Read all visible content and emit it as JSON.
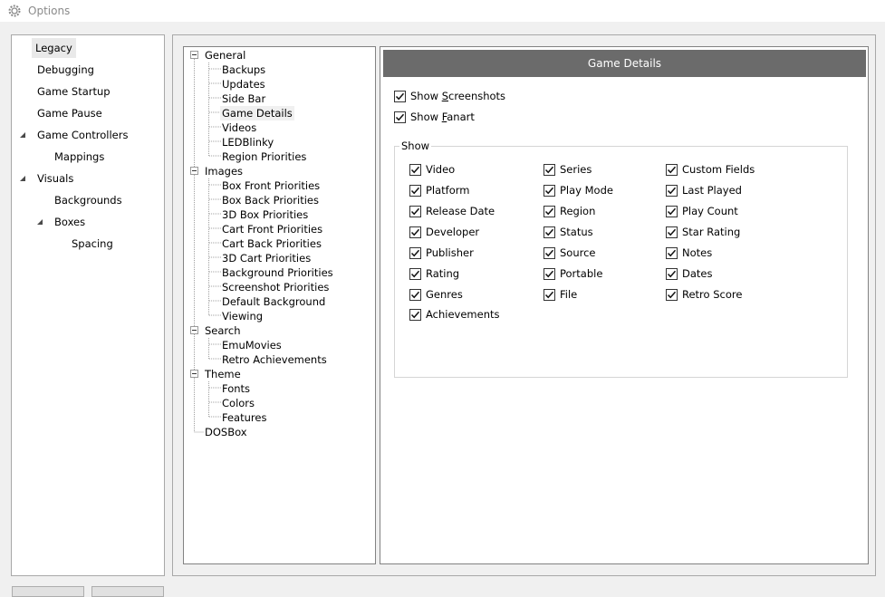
{
  "window": {
    "title": "Options"
  },
  "nav": {
    "items": [
      {
        "label": "Legacy"
      },
      {
        "label": "Debugging"
      },
      {
        "label": "Game Startup"
      },
      {
        "label": "Game Pause"
      },
      {
        "label": "Game Controllers"
      },
      {
        "label": "Mappings"
      },
      {
        "label": "Visuals"
      },
      {
        "label": "Backgrounds"
      },
      {
        "label": "Boxes"
      },
      {
        "label": "Spacing"
      }
    ]
  },
  "tree": {
    "items": [
      {
        "label": "General"
      },
      {
        "label": "Backups"
      },
      {
        "label": "Updates"
      },
      {
        "label": "Side Bar"
      },
      {
        "label": "Game Details"
      },
      {
        "label": "Videos"
      },
      {
        "label": "LEDBlinky"
      },
      {
        "label": "Region Priorities"
      },
      {
        "label": "Images"
      },
      {
        "label": "Box Front Priorities"
      },
      {
        "label": "Box Back Priorities"
      },
      {
        "label": "3D Box Priorities"
      },
      {
        "label": "Cart Front Priorities"
      },
      {
        "label": "Cart Back Priorities"
      },
      {
        "label": "3D Cart Priorities"
      },
      {
        "label": "Background Priorities"
      },
      {
        "label": "Screenshot Priorities"
      },
      {
        "label": "Default Background"
      },
      {
        "label": "Viewing"
      },
      {
        "label": "Search"
      },
      {
        "label": "EmuMovies"
      },
      {
        "label": "Retro Achievements"
      },
      {
        "label": "Theme"
      },
      {
        "label": "Fonts"
      },
      {
        "label": "Colors"
      },
      {
        "label": "Features"
      },
      {
        "label": "DOSBox"
      }
    ]
  },
  "content": {
    "header": "Game Details",
    "show_screenshots": {
      "pre": "Show ",
      "key": "S",
      "post": "creenshots",
      "checked": true
    },
    "show_fanart": {
      "pre": "Show ",
      "key": "F",
      "post": "anart",
      "checked": true
    },
    "group_label": "Show",
    "options": [
      {
        "label": "Video",
        "checked": true
      },
      {
        "label": "Platform",
        "checked": true
      },
      {
        "label": "Release Date",
        "checked": true
      },
      {
        "label": "Developer",
        "checked": true
      },
      {
        "label": "Publisher",
        "checked": true
      },
      {
        "label": "Rating",
        "checked": true
      },
      {
        "label": "Genres",
        "checked": true
      },
      {
        "label": "Achievements",
        "checked": true
      },
      {
        "label": "Series",
        "checked": true
      },
      {
        "label": "Play Mode",
        "checked": true
      },
      {
        "label": "Region",
        "checked": true
      },
      {
        "label": "Status",
        "checked": true
      },
      {
        "label": "Source",
        "checked": true
      },
      {
        "label": "Portable",
        "checked": true
      },
      {
        "label": "File",
        "checked": true
      },
      {
        "label": "Custom Fields",
        "checked": true
      },
      {
        "label": "Last Played",
        "checked": true
      },
      {
        "label": "Play Count",
        "checked": true
      },
      {
        "label": "Star Rating",
        "checked": true
      },
      {
        "label": "Notes",
        "checked": true
      },
      {
        "label": "Dates",
        "checked": true
      },
      {
        "label": "Retro Score",
        "checked": true
      }
    ]
  }
}
